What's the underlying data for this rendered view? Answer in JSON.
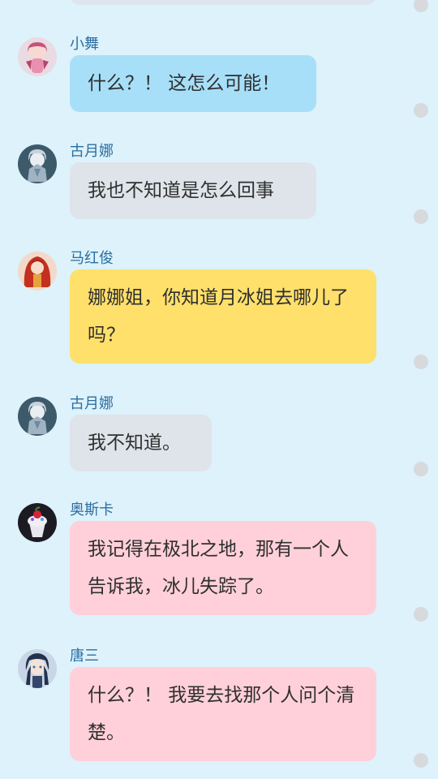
{
  "messages": [
    {
      "name": "小舞",
      "text": "什么？！ 这怎么可能！",
      "style": "blue",
      "avatar_icon": "pink-hair-girl-avatar-icon"
    },
    {
      "name": "古月娜",
      "text": "我也不知道是怎么回事",
      "style": "gray",
      "avatar_icon": "silver-hair-girl-avatar-icon"
    },
    {
      "name": "马红俊",
      "text": "娜娜姐，你知道月冰姐去哪儿了吗？",
      "style": "yellow",
      "avatar_icon": "red-hair-avatar-icon"
    },
    {
      "name": "古月娜",
      "text": "我不知道。",
      "style": "gray",
      "avatar_icon": "silver-hair-girl-avatar-icon"
    },
    {
      "name": "奥斯卡",
      "text": "我记得在极北之地，那有一个人告诉我，冰儿失踪了。",
      "style": "pink",
      "avatar_icon": "dessert-avatar-icon"
    },
    {
      "name": "唐三",
      "text": "什么？！ 我要去找那个人问个清楚。",
      "style": "pink",
      "avatar_icon": "dark-hair-boy-avatar-icon"
    }
  ],
  "colors": {
    "background": "#ddf2fb",
    "bubble_blue": "#a7dff8",
    "bubble_gray": "#dfe4ea",
    "bubble_yellow": "#ffe06b",
    "bubble_pink": "#ffd0da",
    "name_text": "#2b6ea1",
    "dot": "#d7d9dc"
  }
}
